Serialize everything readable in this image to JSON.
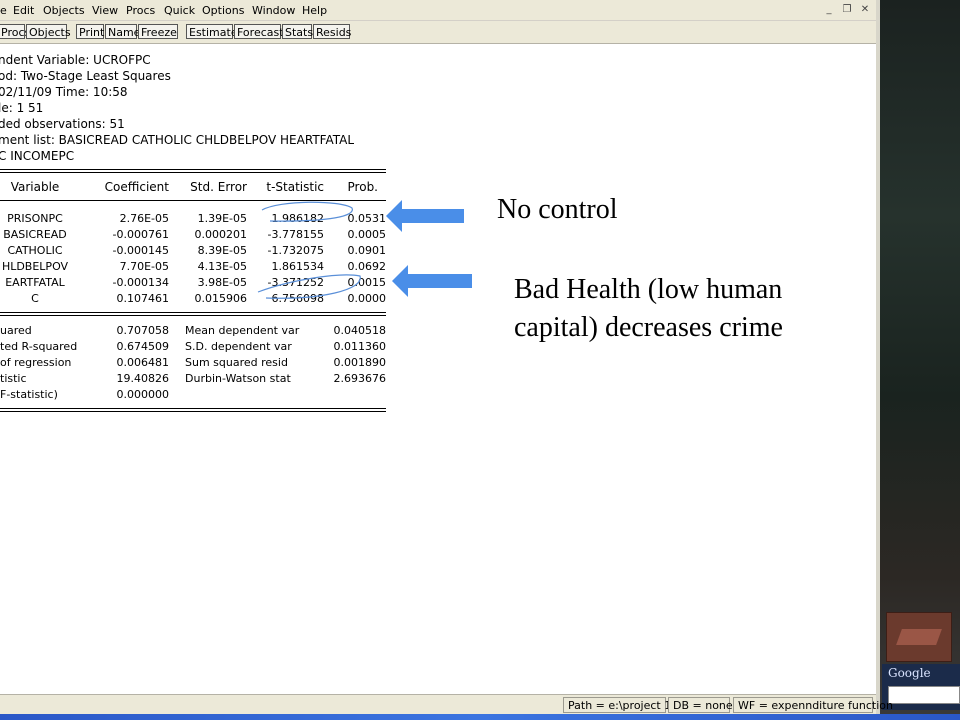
{
  "menu": [
    "e",
    "Edit",
    "Objects",
    "View",
    "Procs",
    "Quick",
    "Options",
    "Window",
    "Help"
  ],
  "window_controls": {
    "minimize": "_",
    "restore": "❐",
    "close": "✕"
  },
  "toolbar": [
    "Procs",
    "Objects",
    "Print",
    "Name",
    "Freeze",
    "Estimate",
    "Forecast",
    "Stats",
    "Resids"
  ],
  "header": [
    "ndent Variable: UCROFPC",
    "od: Two-Stage Least Squares",
    " 02/11/09   Time: 10:58",
    "le: 1 51",
    "ded observations: 51",
    "ment list: BASICREAD CATHOLIC CHLDBELPOV HEARTFATAL",
    "C INCOMEPC"
  ],
  "table": {
    "columns": [
      "Variable",
      "Coefficient",
      "Std. Error",
      "t-Statistic",
      "Prob."
    ],
    "rows": [
      [
        "PRISONPC",
        "2.76E-05",
        "1.39E-05",
        "1.986182",
        "0.0531"
      ],
      [
        "BASICREAD",
        "-0.000761",
        "0.000201",
        "-3.778155",
        "0.0005"
      ],
      [
        "CATHOLIC",
        "-0.000145",
        "8.39E-05",
        "-1.732075",
        "0.0901"
      ],
      [
        "HLDBELPOV",
        "7.70E-05",
        "4.13E-05",
        "1.861534",
        "0.0692"
      ],
      [
        "EARTFATAL",
        "-0.000134",
        "3.98E-05",
        "-3.371252",
        "0.0015"
      ],
      [
        "C",
        "0.107461",
        "0.015906",
        "6.756098",
        "0.0000"
      ]
    ]
  },
  "stats": [
    [
      "uared",
      "0.707058",
      "Mean dependent var",
      "0.040518"
    ],
    [
      "ted R-squared",
      "0.674509",
      "S.D. dependent var",
      "0.011360"
    ],
    [
      "of regression",
      "0.006481",
      "Sum squared resid",
      "0.001890"
    ],
    [
      "tistic",
      "19.40826",
      "Durbin-Watson stat",
      "2.693676"
    ],
    [
      "F-statistic)",
      "0.000000",
      "",
      ""
    ]
  ],
  "status": {
    "path": "Path = e:\\project 1",
    "db": "DB = none",
    "wf": "WF = expennditure function"
  },
  "google_label": "Google",
  "annotations": {
    "note1": "No control",
    "note2_line1": "Bad Health (low human",
    "note2_line2": "capital) decreases crime"
  },
  "colors": {
    "arrow": "#4a8ee8",
    "pen": "#5a8fd8"
  }
}
